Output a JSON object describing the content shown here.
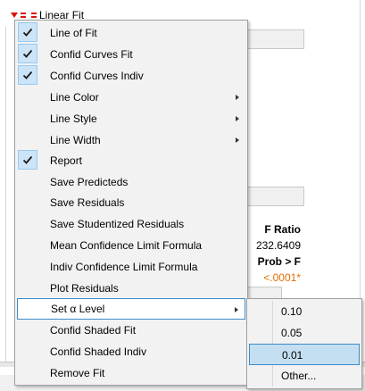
{
  "report": {
    "outline_title": "Linear Fit",
    "stats_header": "F Ratio",
    "f_ratio_value": "232.6409",
    "prob_header": "Prob > F",
    "prob_value": "<.0001*"
  },
  "menu": {
    "items": [
      {
        "label": "Line of Fit",
        "checked": true,
        "submenu": false
      },
      {
        "label": "Confid Curves Fit",
        "checked": true,
        "submenu": false
      },
      {
        "label": "Confid Curves Indiv",
        "checked": true,
        "submenu": false
      },
      {
        "label": "Line Color",
        "checked": false,
        "submenu": true
      },
      {
        "label": "Line Style",
        "checked": false,
        "submenu": true
      },
      {
        "label": "Line Width",
        "checked": false,
        "submenu": true
      },
      {
        "label": "Report",
        "checked": true,
        "submenu": false
      },
      {
        "label": "Save Predicteds",
        "checked": false,
        "submenu": false
      },
      {
        "label": "Save Residuals",
        "checked": false,
        "submenu": false
      },
      {
        "label": "Save Studentized Residuals",
        "checked": false,
        "submenu": false
      },
      {
        "label": "Mean Confidence Limit Formula",
        "checked": false,
        "submenu": false
      },
      {
        "label": "Indiv Confidence Limit Formula",
        "checked": false,
        "submenu": false
      },
      {
        "label": "Plot Residuals",
        "checked": false,
        "submenu": false
      },
      {
        "label": "Set α Level",
        "checked": false,
        "submenu": true,
        "highlighted": true
      },
      {
        "label": "Confid Shaded Fit",
        "checked": false,
        "submenu": false
      },
      {
        "label": "Confid Shaded Indiv",
        "checked": false,
        "submenu": false
      },
      {
        "label": "Remove Fit",
        "checked": false,
        "submenu": false
      }
    ]
  },
  "alpha_submenu": {
    "items": [
      {
        "label": "0.10",
        "selected": false
      },
      {
        "label": "0.05",
        "selected": false
      },
      {
        "label": "0.01",
        "selected": true
      },
      {
        "label": "Other...",
        "selected": false
      }
    ]
  },
  "colors": {
    "accent": "#3c8cc8",
    "check_bg": "#cce4f7",
    "significant": "#e07000",
    "hotspot": "#dd1111"
  }
}
